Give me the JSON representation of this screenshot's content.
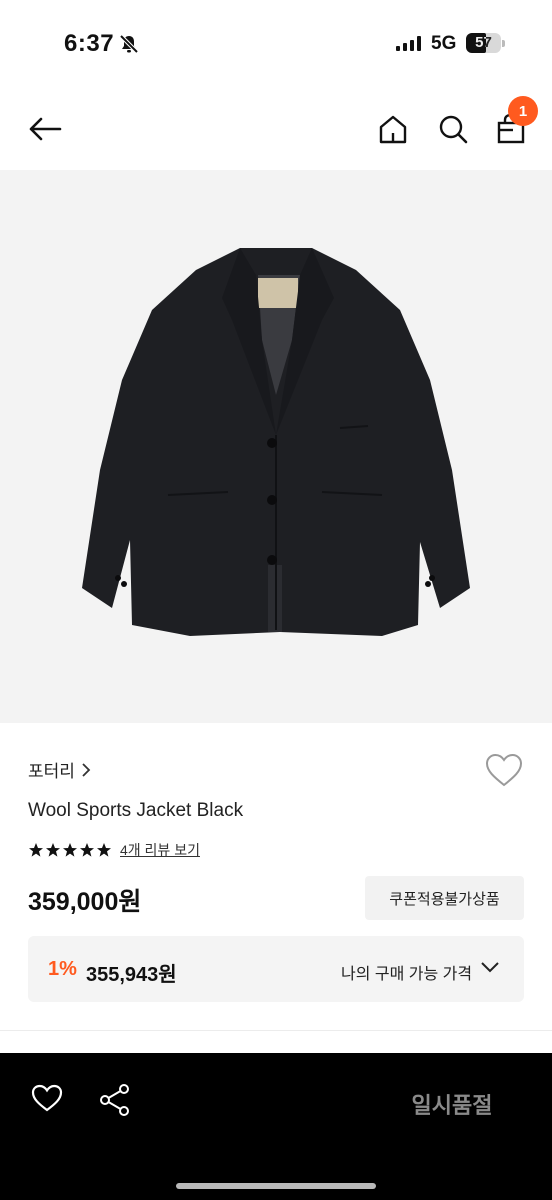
{
  "status_bar": {
    "time": "6:37",
    "network": "5G",
    "battery": "57"
  },
  "header": {
    "back_icon": "arrow-left-icon",
    "home_icon": "home-icon",
    "search_icon": "search-icon",
    "cart_icon": "shopping-bag-icon",
    "cart_badge": "1"
  },
  "product": {
    "image": "black wool sports jacket",
    "brand": "포터리",
    "name": "Wool Sports Jacket Black",
    "rating": 5,
    "review_link": "4개 리뷰 보기",
    "price": "359,000원",
    "coupon_badge": "쿠폰적용불가상품",
    "my_price": {
      "discount": "1%",
      "price": "355,943원",
      "label": "나의 구매 가능 가격"
    }
  },
  "bottom_bar": {
    "wish_icon": "heart-icon",
    "share_icon": "share-icon",
    "soldout_label": "일시품절"
  },
  "colors": {
    "accent": "#ff5a1f",
    "bottom_bar_bg": "#000000"
  }
}
